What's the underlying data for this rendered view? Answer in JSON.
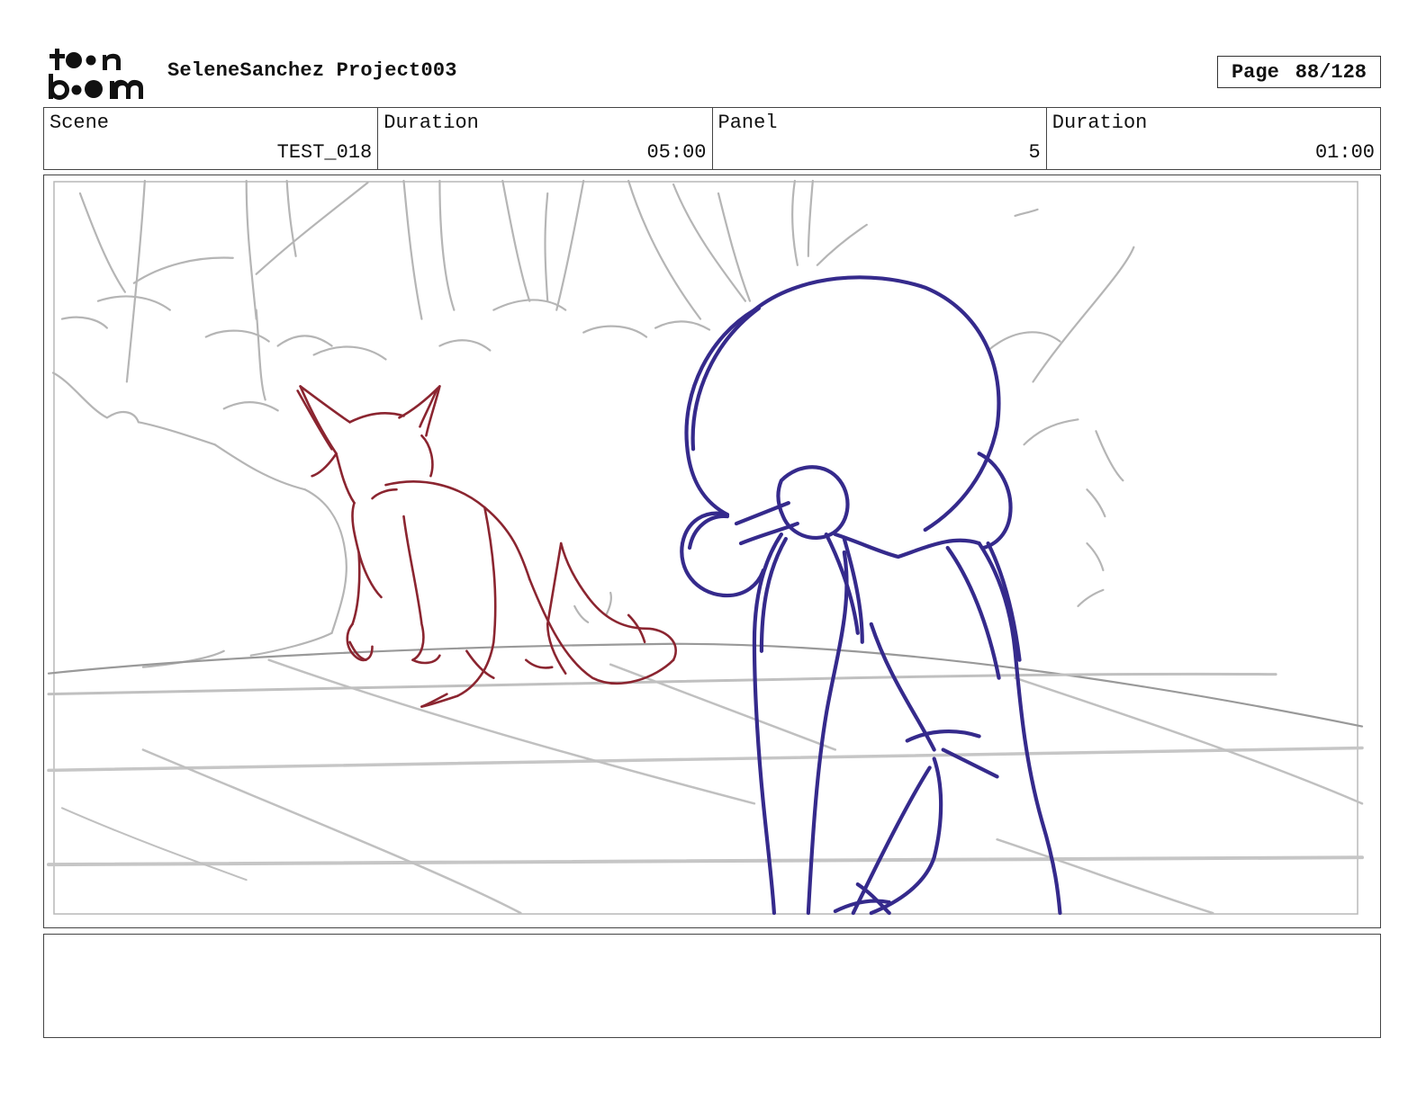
{
  "header": {
    "logo_text": "toon boom",
    "project_title": "SeleneSanchez Project003",
    "page_label": "Page",
    "page_number": "88/128"
  },
  "info": {
    "scene_label": "Scene",
    "scene_value": "TEST_018",
    "scene_duration_label": "Duration",
    "scene_duration_value": "05:00",
    "panel_label": "Panel",
    "panel_value": "5",
    "panel_duration_label": "Duration",
    "panel_duration_value": "01:00"
  },
  "colors": {
    "background_sketch": "#b5b5b5",
    "fox_sketch": "#8b2530",
    "character_sketch": "#352a8c"
  },
  "notes": {
    "text": ""
  }
}
